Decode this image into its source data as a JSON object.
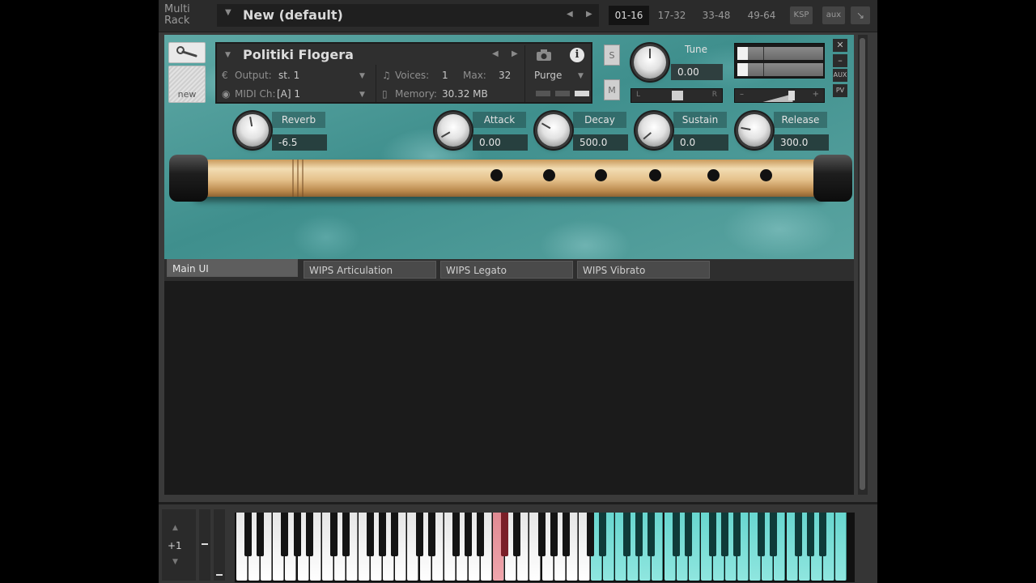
{
  "rack": {
    "label_line1": "Multi",
    "label_line2": "Rack",
    "preset_name": "New (default)",
    "tabs": [
      "01-16",
      "17-32",
      "33-48",
      "49-64"
    ],
    "active_tab": "01-16",
    "ksp_label": "KSP",
    "aux_label": "aux"
  },
  "instrument": {
    "name": "Politiki Flogera",
    "output_label": "Output:",
    "output_value": "st. 1",
    "midi_label": "MIDI Ch:",
    "midi_value": "[A]  1",
    "voices_label": "Voices:",
    "voices_value": "1",
    "max_label": "Max:",
    "max_value": "32",
    "memory_label": "Memory:",
    "memory_value": "30.32 MB",
    "purge_label": "Purge",
    "new_label": "new",
    "solo_label": "S",
    "mute_label": "M",
    "tune_label": "Tune",
    "tune_value": "0.00",
    "pan_left": "L",
    "pan_right": "R",
    "aux_small": "AUX",
    "pv_small": "PV"
  },
  "knobs": {
    "reverb": {
      "label": "Reverb",
      "value": "-6.5"
    },
    "attack": {
      "label": "Attack",
      "value": "0.00"
    },
    "decay": {
      "label": "Decay",
      "value": "500.0"
    },
    "sustain": {
      "label": "Sustain",
      "value": "0.0"
    },
    "release": {
      "label": "Release",
      "value": "300.0"
    }
  },
  "tabs": [
    {
      "label": "Main UI"
    },
    {
      "label": "WIPS Articulation"
    },
    {
      "label": "WIPS Legato"
    },
    {
      "label": "WIPS Vibrato"
    }
  ],
  "keyboard": {
    "octave_label": "+1",
    "minus_label": "-"
  },
  "colors": {
    "accent_keys": "#68d6cf",
    "pressed_keys": "#e08a92"
  }
}
